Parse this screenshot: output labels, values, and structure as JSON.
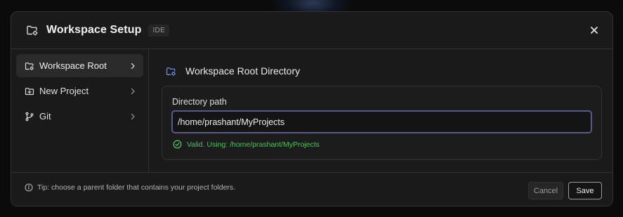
{
  "header": {
    "icon": "folder-settings-icon",
    "title": "Workspace Setup",
    "badge": "IDE",
    "close_icon": "close-icon"
  },
  "sidebar": {
    "items": [
      {
        "label": "Workspace Root",
        "icon": "folder-settings-icon",
        "active": true
      },
      {
        "label": "New Project",
        "icon": "folder-plus-icon",
        "active": false
      },
      {
        "label": "Git",
        "icon": "git-branch-icon",
        "active": false
      }
    ]
  },
  "main": {
    "section_title": "Workspace Root Directory",
    "field_label": "Directory path",
    "directory_value": "/home/prashant/MyProjects",
    "validation_text": "Valid. Using: /home/prashant/MyProjects"
  },
  "footer": {
    "tip": "Tip: choose a parent folder that contains your project folders.",
    "cancel_label": "Cancel",
    "save_label": "Save"
  },
  "colors": {
    "accent_blue": "#6b8ce6",
    "valid_green": "#4cc15f",
    "input_border": "#565c8a"
  }
}
